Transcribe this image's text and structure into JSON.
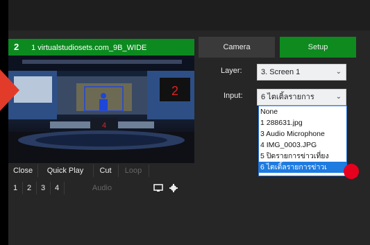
{
  "input_title": {
    "number": "2",
    "name": "1 virtualstudiosets.com_9B_WIDE"
  },
  "preview": {
    "screen_numbers": [
      "2",
      "4"
    ]
  },
  "controls": {
    "row1": [
      "Close",
      "Quick Play",
      "Cut",
      "Loop"
    ],
    "row2_numbers": [
      "1",
      "2",
      "3",
      "4"
    ],
    "audio_label": "Audio",
    "icons": [
      "monitor-icon",
      "gear-icon"
    ]
  },
  "tabs": {
    "camera": "Camera",
    "setup": "Setup"
  },
  "layer": {
    "label": "Layer:",
    "value": "3. Screen 1"
  },
  "input": {
    "label": "Input:",
    "value": "6 ไตเติ้ลรายการ",
    "options": [
      "None",
      "1 288631.jpg",
      "3 Audio Microphone",
      "4 IMG_0003.JPG",
      "5 ปิดรายการข่าวเที่ยง",
      "6 ไตเติ้ลรายการข่าวเ"
    ],
    "selected_index": 5
  },
  "colors": {
    "green": "#0c8a20",
    "accent": "#1e7be0",
    "marker": "#e6001e"
  }
}
